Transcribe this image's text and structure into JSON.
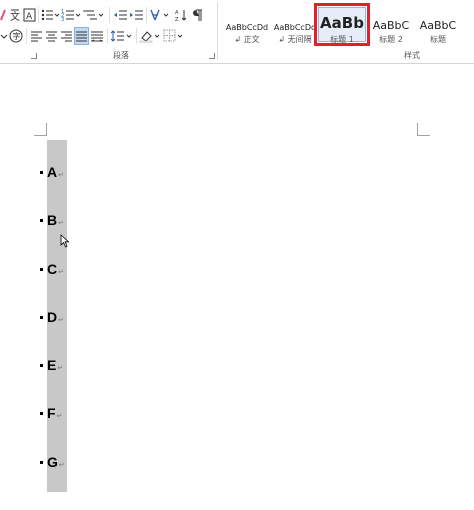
{
  "ribbon": {
    "paragraph_group": {
      "label": "段落"
    },
    "styles_group": {
      "label": "样式"
    },
    "styles": [
      {
        "preview": "AaBbCcDd",
        "name": "↲ 正文",
        "selected": false
      },
      {
        "preview": "AaBbCcDd",
        "name": "↲ 无间隔",
        "selected": false
      },
      {
        "preview": "AaBb",
        "name": "标题 1",
        "selected": true
      },
      {
        "preview": "AaBbC",
        "name": "标题 2",
        "selected": false
      },
      {
        "preview": "AaBbC",
        "name": "标题",
        "selected": false
      }
    ],
    "selection_color": "#e0202a"
  },
  "document": {
    "paragraphs": [
      {
        "text": "A",
        "mark": "↵"
      },
      {
        "text": "B",
        "mark": "↵"
      },
      {
        "text": "C",
        "mark": "↵"
      },
      {
        "text": "D",
        "mark": "↵"
      },
      {
        "text": "E",
        "mark": "↵"
      },
      {
        "text": "F",
        "mark": "↵"
      },
      {
        "text": "G",
        "mark": "↵"
      }
    ],
    "highlight_color": "#c8c8c8"
  }
}
